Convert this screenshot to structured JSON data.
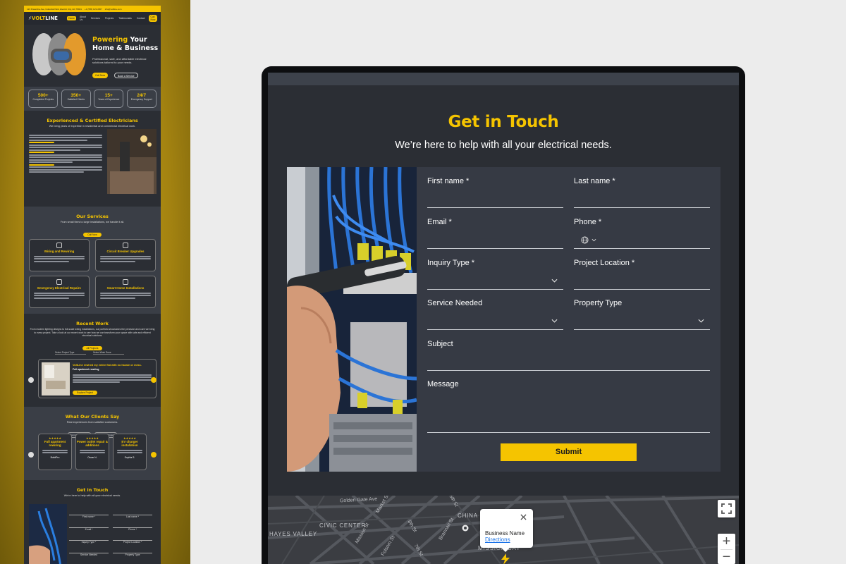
{
  "mini_site": {
    "topbar": [
      "123 Powerline Ave, Industrial Park, Electric City, EC 78901",
      "+1 (555) 123-4567",
      "info@voltline.com"
    ],
    "brand": {
      "prefix": "VOLT",
      "suffix": "LINE"
    },
    "nav": [
      "Home",
      "About Us",
      "Services",
      "Projects",
      "Testimonials",
      "Contact"
    ],
    "nav_cta": "Call Now",
    "hero": {
      "title_accent": "Powering",
      "title_rest": "Your",
      "title_line2": "Home & Business",
      "text": "Professional, safe, and affordable electrical solutions tailored to your needs.",
      "btn_primary": "Call Now",
      "btn_secondary": "Book a Service"
    },
    "stats": [
      {
        "value": "500+",
        "label": "Completed Projects"
      },
      {
        "value": "350+",
        "label": "Satisfied Clients"
      },
      {
        "value": "15+",
        "label": "Years of Experience"
      },
      {
        "value": "24/7",
        "label": "Emergency Support"
      }
    ],
    "about": {
      "title": "Experienced & Certified Electricians",
      "subtitle": "We bring years of expertise in residential and commercial electrical work.",
      "headings": [
        "WHO WE ARE",
        "WHAT WE DO",
        "OUR PROMISE"
      ]
    },
    "services": {
      "title": "Our Services",
      "subtitle": "From small fixes to large installations, we handle it all.",
      "cta": "Call Now",
      "cards": [
        "Wiring and Rewiring",
        "Circuit Breaker Upgrades",
        "Emergency Electrical Repairs",
        "Smart Home Installations"
      ]
    },
    "work": {
      "title": "Recent Work",
      "subtitle": "From modern lighting designs to full-scale wiring installations, our portfolio showcases the precision and care we bring to every project. Take a look at our recent work to see how we can transform your space with safe and efficient electrical solutions.",
      "cta": "All Projects",
      "filters": [
        "Select Project Type",
        "Select Work Done"
      ],
      "card_title": "VoltLine rewired my entire flat with no hassle or mess.",
      "card_sub": "Full apartment rewiring",
      "card_btn": "Explore Project"
    },
    "reviews": {
      "title": "What Our Clients Say",
      "subtitle": "Real experiences from satisfied customers.",
      "filters": [
        "Commercial project",
        "Residential project"
      ],
      "cards": [
        {
          "title": "Full apartment rewiring",
          "author": "BuildPro"
        },
        {
          "title": "Power outlet repair & additions",
          "author": "Oscar N."
        },
        {
          "title": "EV charger installation",
          "author": "Sophia S."
        }
      ]
    },
    "contact": {
      "title": "Get in Touch",
      "subtitle": "We're here to help with all your electrical needs."
    }
  },
  "contact": {
    "title": "Get in Touch",
    "subtitle": "We’re here to help with all your electrical needs.",
    "fields": {
      "first_name": "First name *",
      "last_name": "Last name *",
      "email": "Email *",
      "phone": "Phone *",
      "inquiry_type": "Inquiry Type *",
      "project_location": "Project Location *",
      "service_needed": "Service Needed",
      "property_type": "Property Type",
      "subject": "Subject",
      "message": "Message"
    },
    "submit": "Submit"
  },
  "map": {
    "areas": [
      "HAYES VALLEY",
      "CIVIC CENTER",
      "CHINA B",
      "MISSION BAY"
    ],
    "streets": [
      "Golden Gate Ave",
      "Market St",
      "Mission St",
      "Folsom St",
      "8th St",
      "7th St",
      "Brannan St",
      "5th St"
    ],
    "popup": {
      "name": "Business Name",
      "link": "Directions"
    },
    "zoom_in": "+",
    "zoom_out": "−"
  },
  "colors": {
    "accent": "#f5c400",
    "panel": "#363a44",
    "background": "#2b2e34"
  }
}
